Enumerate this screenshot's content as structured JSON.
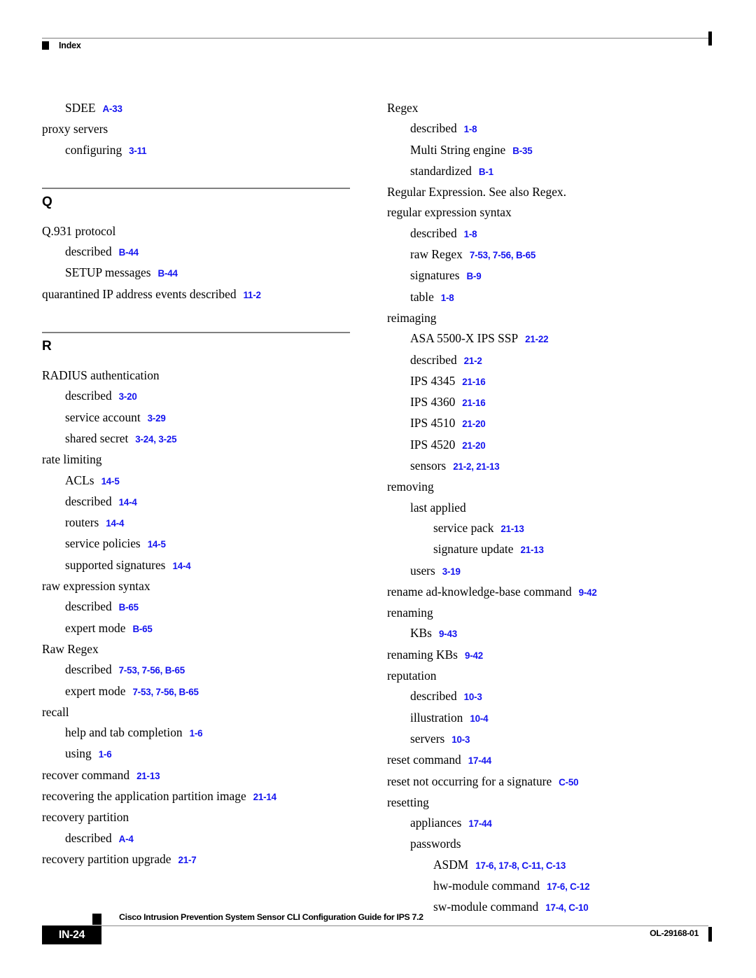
{
  "header": {
    "title": "Index",
    "square_icon": "black-square-icon"
  },
  "colors": {
    "link_blue": "#1414f0",
    "rule_gray": "#808080",
    "text_black": "#000000"
  },
  "columns": {
    "left": {
      "continued_entries": [
        {
          "level": 1,
          "term": "SDEE",
          "refs": "A-33"
        },
        {
          "level": 0,
          "term": "proxy servers",
          "refs": ""
        },
        {
          "level": 1,
          "term": "configuring",
          "refs": "3-11"
        }
      ],
      "sections": [
        {
          "letter": "Q",
          "entries": [
            {
              "level": 0,
              "term": "Q.931 protocol",
              "refs": ""
            },
            {
              "level": 1,
              "term": "described",
              "refs": "B-44"
            },
            {
              "level": 1,
              "term": "SETUP messages",
              "refs": "B-44"
            },
            {
              "level": 0,
              "term": "quarantined IP address events described",
              "refs": "11-2"
            }
          ]
        },
        {
          "letter": "R",
          "entries": [
            {
              "level": 0,
              "term": "RADIUS authentication",
              "refs": ""
            },
            {
              "level": 1,
              "term": "described",
              "refs": "3-20"
            },
            {
              "level": 1,
              "term": "service account",
              "refs": "3-29"
            },
            {
              "level": 1,
              "term": "shared secret",
              "refs": "3-24, 3-25"
            },
            {
              "level": 0,
              "term": "rate limiting",
              "refs": ""
            },
            {
              "level": 1,
              "term": "ACLs",
              "refs": "14-5"
            },
            {
              "level": 1,
              "term": "described",
              "refs": "14-4"
            },
            {
              "level": 1,
              "term": "routers",
              "refs": "14-4"
            },
            {
              "level": 1,
              "term": "service policies",
              "refs": "14-5"
            },
            {
              "level": 1,
              "term": "supported signatures",
              "refs": "14-4"
            },
            {
              "level": 0,
              "term": "raw expression syntax",
              "refs": ""
            },
            {
              "level": 1,
              "term": "described",
              "refs": "B-65"
            },
            {
              "level": 1,
              "term": "expert mode",
              "refs": "B-65"
            },
            {
              "level": 0,
              "term": "Raw Regex",
              "refs": ""
            },
            {
              "level": 1,
              "term": "described",
              "refs": "7-53, 7-56, B-65"
            },
            {
              "level": 1,
              "term": "expert mode",
              "refs": "7-53, 7-56, B-65"
            },
            {
              "level": 0,
              "term": "recall",
              "refs": ""
            },
            {
              "level": 1,
              "term": "help and tab completion",
              "refs": "1-6"
            },
            {
              "level": 1,
              "term": "using",
              "refs": "1-6"
            },
            {
              "level": 0,
              "term": "recover command",
              "refs": "21-13"
            },
            {
              "level": 0,
              "term": "recovering the application partition image",
              "refs": "21-14"
            },
            {
              "level": 0,
              "term": "recovery partition",
              "refs": ""
            },
            {
              "level": 1,
              "term": "described",
              "refs": "A-4"
            },
            {
              "level": 0,
              "term": "recovery partition upgrade",
              "refs": "21-7"
            }
          ]
        }
      ]
    },
    "right": {
      "entries": [
        {
          "level": 0,
          "term": "Regex",
          "refs": ""
        },
        {
          "level": 1,
          "term": "described",
          "refs": "1-8"
        },
        {
          "level": 1,
          "term": "Multi String engine",
          "refs": "B-35"
        },
        {
          "level": 1,
          "term": "standardized",
          "refs": "B-1"
        },
        {
          "level": 0,
          "term": "Regular Expression. See also Regex.",
          "refs": ""
        },
        {
          "level": 0,
          "term": "regular expression syntax",
          "refs": ""
        },
        {
          "level": 1,
          "term": "described",
          "refs": "1-8"
        },
        {
          "level": 1,
          "term": "raw Regex",
          "refs": "7-53, 7-56, B-65"
        },
        {
          "level": 1,
          "term": "signatures",
          "refs": "B-9"
        },
        {
          "level": 1,
          "term": "table",
          "refs": "1-8"
        },
        {
          "level": 0,
          "term": "reimaging",
          "refs": ""
        },
        {
          "level": 1,
          "term": "ASA 5500-X IPS SSP",
          "refs": "21-22"
        },
        {
          "level": 1,
          "term": "described",
          "refs": "21-2"
        },
        {
          "level": 1,
          "term": "IPS 4345",
          "refs": "21-16"
        },
        {
          "level": 1,
          "term": "IPS 4360",
          "refs": "21-16"
        },
        {
          "level": 1,
          "term": "IPS 4510",
          "refs": "21-20"
        },
        {
          "level": 1,
          "term": "IPS 4520",
          "refs": "21-20"
        },
        {
          "level": 1,
          "term": "sensors",
          "refs": "21-2, 21-13"
        },
        {
          "level": 0,
          "term": "removing",
          "refs": ""
        },
        {
          "level": 1,
          "term": "last applied",
          "refs": ""
        },
        {
          "level": 2,
          "term": "service pack",
          "refs": "21-13"
        },
        {
          "level": 2,
          "term": "signature update",
          "refs": "21-13"
        },
        {
          "level": 1,
          "term": "users",
          "refs": "3-19"
        },
        {
          "level": 0,
          "term": "rename ad-knowledge-base command",
          "refs": "9-42"
        },
        {
          "level": 0,
          "term": "renaming",
          "refs": ""
        },
        {
          "level": 1,
          "term": "KBs",
          "refs": "9-43"
        },
        {
          "level": 0,
          "term": "renaming KBs",
          "refs": "9-42"
        },
        {
          "level": 0,
          "term": "reputation",
          "refs": ""
        },
        {
          "level": 1,
          "term": "described",
          "refs": "10-3"
        },
        {
          "level": 1,
          "term": "illustration",
          "refs": "10-4"
        },
        {
          "level": 1,
          "term": "servers",
          "refs": "10-3"
        },
        {
          "level": 0,
          "term": "reset command",
          "refs": "17-44"
        },
        {
          "level": 0,
          "term": "reset not occurring for a signature",
          "refs": "C-50"
        },
        {
          "level": 0,
          "term": "resetting",
          "refs": ""
        },
        {
          "level": 1,
          "term": "appliances",
          "refs": "17-44"
        },
        {
          "level": 1,
          "term": "passwords",
          "refs": ""
        },
        {
          "level": 2,
          "term": "ASDM",
          "refs": "17-6, 17-8, C-11, C-13"
        },
        {
          "level": 2,
          "term": "hw-module command",
          "refs": "17-6, C-12"
        },
        {
          "level": 2,
          "term": "sw-module command",
          "refs": "17-4, C-10"
        }
      ]
    }
  },
  "footer": {
    "guide_title": "Cisco Intrusion Prevention System Sensor CLI Configuration Guide for IPS 7.2",
    "page_number": "IN-24",
    "doc_id": "OL-29168-01"
  }
}
